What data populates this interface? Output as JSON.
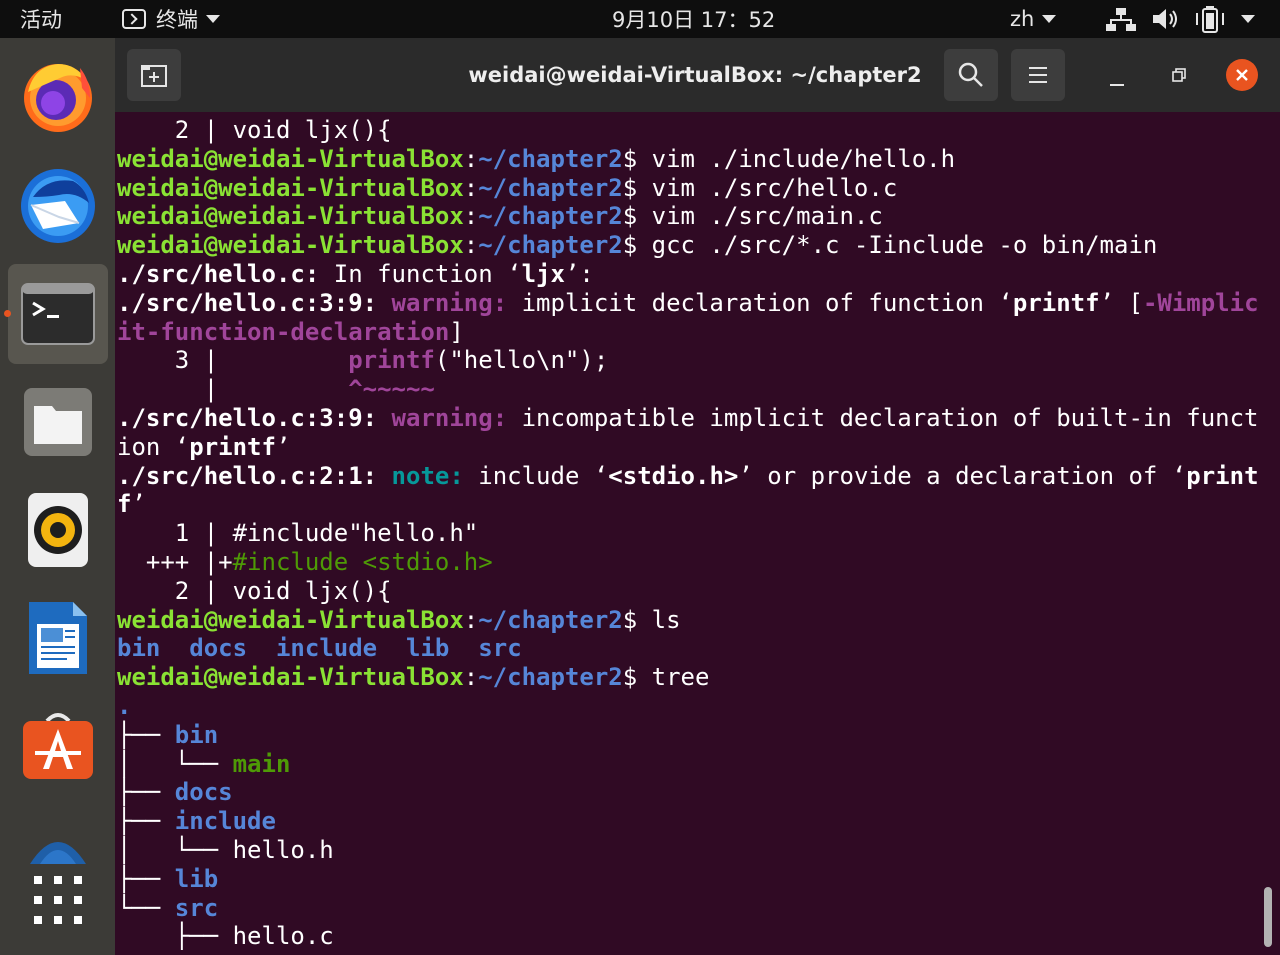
{
  "topbar": {
    "activities": "活动",
    "app_menu": "终端",
    "clock": "9月10日  17：52",
    "input_method": "zh"
  },
  "dock": {
    "items": [
      {
        "name": "firefox-icon"
      },
      {
        "name": "thunderbird-icon"
      },
      {
        "name": "terminal-icon"
      },
      {
        "name": "files-icon"
      },
      {
        "name": "rhythmbox-icon"
      },
      {
        "name": "libreoffice-writer-icon"
      },
      {
        "name": "software-center-icon"
      },
      {
        "name": "help-icon"
      },
      {
        "name": "show-applications-icon"
      }
    ]
  },
  "window": {
    "title": "weidai@weidai-VirtualBox: ~/chapter2"
  },
  "terminal": {
    "prompt_user": "weidai@weidai-VirtualBox",
    "prompt_path": "~/chapter2",
    "lines": [
      [
        {
          "t": "    2 | void ljx(){"
        }
      ],
      [
        {
          "t": "weidai@weidai-VirtualBox",
          "c": "g"
        },
        {
          "t": ":"
        },
        {
          "t": "~/chapter2",
          "c": "b"
        },
        {
          "t": "$ vim ./include/hello.h"
        }
      ],
      [
        {
          "t": "weidai@weidai-VirtualBox",
          "c": "g"
        },
        {
          "t": ":"
        },
        {
          "t": "~/chapter2",
          "c": "b"
        },
        {
          "t": "$ vim ./src/hello.c"
        }
      ],
      [
        {
          "t": "weidai@weidai-VirtualBox",
          "c": "g"
        },
        {
          "t": ":"
        },
        {
          "t": "~/chapter2",
          "c": "b"
        },
        {
          "t": "$ vim ./src/main.c"
        }
      ],
      [
        {
          "t": "weidai@weidai-VirtualBox",
          "c": "g"
        },
        {
          "t": ":"
        },
        {
          "t": "~/chapter2",
          "c": "b"
        },
        {
          "t": "$ gcc ./src/*.c -Iinclude -o bin/main"
        }
      ],
      [
        {
          "t": "./src/hello.c:",
          "c": "bold"
        },
        {
          "t": " In function ‘"
        },
        {
          "t": "ljx",
          "c": "bold"
        },
        {
          "t": "’:"
        }
      ],
      [
        {
          "t": "./src/hello.c:3:9:",
          "c": "bold"
        },
        {
          "t": " "
        },
        {
          "t": "warning:",
          "c": "w"
        },
        {
          "t": " implicit declaration of function ‘"
        },
        {
          "t": "printf",
          "c": "bold"
        },
        {
          "t": "’ ["
        },
        {
          "t": "-Wimplic",
          "c": "w"
        }
      ],
      [
        {
          "t": "it-function-declaration",
          "c": "w"
        },
        {
          "t": "]"
        }
      ],
      [
        {
          "t": "    3 |         "
        },
        {
          "t": "printf",
          "c": "w"
        },
        {
          "t": "(\"hello\\n\");"
        }
      ],
      [
        {
          "t": "      |         "
        },
        {
          "t": "^~~~~~",
          "c": "w"
        }
      ],
      [
        {
          "t": "./src/hello.c:3:9:",
          "c": "bold"
        },
        {
          "t": " "
        },
        {
          "t": "warning:",
          "c": "w"
        },
        {
          "t": " incompatible implicit declaration of built-in funct"
        }
      ],
      [
        {
          "t": "ion ‘"
        },
        {
          "t": "printf",
          "c": "bold"
        },
        {
          "t": "’"
        }
      ],
      [
        {
          "t": "./src/hello.c:2:1:",
          "c": "bold"
        },
        {
          "t": " "
        },
        {
          "t": "note:",
          "c": "c"
        },
        {
          "t": " include ‘"
        },
        {
          "t": "<stdio.h>",
          "c": "bold"
        },
        {
          "t": "’ or provide a declaration of ‘"
        },
        {
          "t": "print",
          "c": "bold"
        }
      ],
      [
        {
          "t": "f",
          "c": "bold"
        },
        {
          "t": "’"
        }
      ],
      [
        {
          "t": "    1 | #include\"hello.h\""
        }
      ],
      [
        {
          "t": "  +++ |+"
        },
        {
          "t": "#include <stdio.h>",
          "c": "gr"
        }
      ],
      [
        {
          "t": "    2 | void ljx(){"
        }
      ],
      [
        {
          "t": "weidai@weidai-VirtualBox",
          "c": "g"
        },
        {
          "t": ":"
        },
        {
          "t": "~/chapter2",
          "c": "b"
        },
        {
          "t": "$ ls"
        }
      ],
      [
        {
          "t": "bin",
          "c": "b"
        },
        {
          "t": "  "
        },
        {
          "t": "docs",
          "c": "b"
        },
        {
          "t": "  "
        },
        {
          "t": "include",
          "c": "b"
        },
        {
          "t": "  "
        },
        {
          "t": "lib",
          "c": "b"
        },
        {
          "t": "  "
        },
        {
          "t": "src",
          "c": "b"
        }
      ],
      [
        {
          "t": "weidai@weidai-VirtualBox",
          "c": "g"
        },
        {
          "t": ":"
        },
        {
          "t": "~/chapter2",
          "c": "b"
        },
        {
          "t": "$ tree"
        }
      ],
      [
        {
          "t": ".",
          "c": "b"
        }
      ],
      [
        {
          "t": "├── "
        },
        {
          "t": "bin",
          "c": "b"
        }
      ],
      [
        {
          "t": "│   └── "
        },
        {
          "t": "main",
          "c": "gb"
        }
      ],
      [
        {
          "t": "├── "
        },
        {
          "t": "docs",
          "c": "b"
        }
      ],
      [
        {
          "t": "├── "
        },
        {
          "t": "include",
          "c": "b"
        }
      ],
      [
        {
          "t": "│   └── hello.h"
        }
      ],
      [
        {
          "t": "├── "
        },
        {
          "t": "lib",
          "c": "b"
        }
      ],
      [
        {
          "t": "└── "
        },
        {
          "t": "src",
          "c": "b"
        }
      ],
      [
        {
          "t": "    ├── hello.c"
        }
      ]
    ]
  },
  "colors": {
    "terminal_bg": "#300a24",
    "prompt_user": "#8ae234",
    "prompt_path": "#5686d8",
    "warning": "#a0459a",
    "note": "#06989a",
    "close_button": "#e95420"
  }
}
